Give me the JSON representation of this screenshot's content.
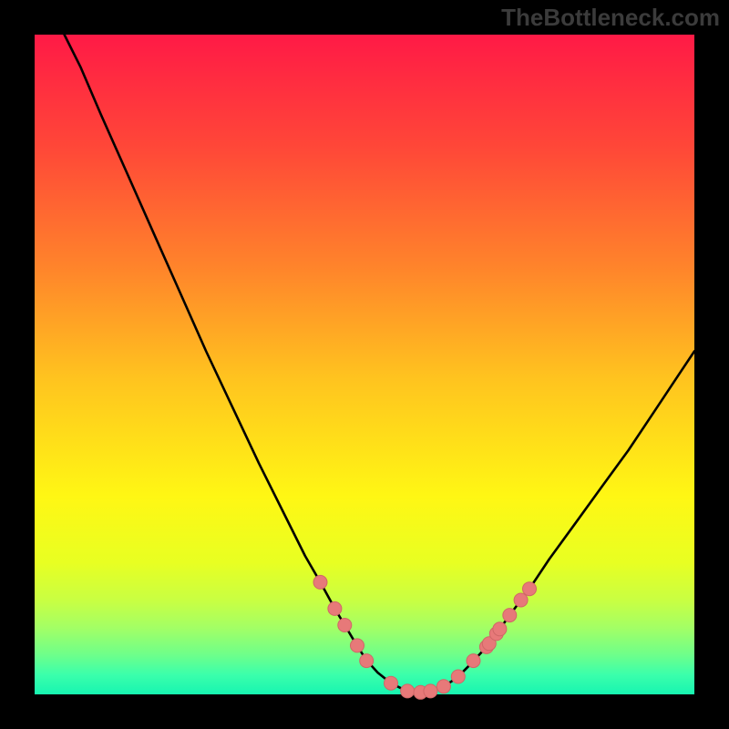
{
  "watermark": "TheBottleneck.com",
  "colors": {
    "background": "#000000",
    "gradient_stops": [
      {
        "offset": 0.0,
        "color": "#ff1a46"
      },
      {
        "offset": 0.17,
        "color": "#ff4738"
      },
      {
        "offset": 0.35,
        "color": "#ff832b"
      },
      {
        "offset": 0.52,
        "color": "#ffc31f"
      },
      {
        "offset": 0.7,
        "color": "#fff714"
      },
      {
        "offset": 0.8,
        "color": "#e8ff22"
      },
      {
        "offset": 0.86,
        "color": "#c7ff44"
      },
      {
        "offset": 0.9,
        "color": "#a2ff66"
      },
      {
        "offset": 0.94,
        "color": "#6eff8a"
      },
      {
        "offset": 0.97,
        "color": "#3bffab"
      },
      {
        "offset": 1.0,
        "color": "#17f5b1"
      }
    ],
    "curve": "#000000",
    "marker_fill": "#e77979",
    "marker_stroke": "#d06767"
  },
  "chart_data": {
    "type": "line",
    "title": "",
    "xlabel": "",
    "ylabel": "",
    "xlim": [
      0,
      100
    ],
    "ylim": [
      0,
      100
    ],
    "note": "y = bottleneck percentage; curve dips to ~0 near x≈58 (optimal match) and rises on both sides",
    "curve": [
      {
        "x": 4.5,
        "y": 100.0
      },
      {
        "x": 7.0,
        "y": 95.0
      },
      {
        "x": 10.0,
        "y": 88.0
      },
      {
        "x": 14.0,
        "y": 79.0
      },
      {
        "x": 18.0,
        "y": 70.0
      },
      {
        "x": 22.0,
        "y": 61.0
      },
      {
        "x": 26.0,
        "y": 52.0
      },
      {
        "x": 30.0,
        "y": 43.5
      },
      {
        "x": 34.0,
        "y": 35.0
      },
      {
        "x": 38.0,
        "y": 27.0
      },
      {
        "x": 41.0,
        "y": 21.0
      },
      {
        "x": 43.3,
        "y": 17.0
      },
      {
        "x": 45.5,
        "y": 13.0
      },
      {
        "x": 47.0,
        "y": 10.5
      },
      {
        "x": 48.5,
        "y": 8.0
      },
      {
        "x": 50.2,
        "y": 5.3
      },
      {
        "x": 52.0,
        "y": 3.3
      },
      {
        "x": 54.0,
        "y": 1.7
      },
      {
        "x": 56.0,
        "y": 0.7
      },
      {
        "x": 58.0,
        "y": 0.3
      },
      {
        "x": 60.0,
        "y": 0.5
      },
      {
        "x": 62.0,
        "y": 1.2
      },
      {
        "x": 64.0,
        "y": 2.5
      },
      {
        "x": 66.0,
        "y": 4.5
      },
      {
        "x": 68.5,
        "y": 7.2
      },
      {
        "x": 70.0,
        "y": 9.2
      },
      {
        "x": 72.0,
        "y": 12.0
      },
      {
        "x": 73.5,
        "y": 14.0
      },
      {
        "x": 75.0,
        "y": 16.0
      },
      {
        "x": 78.0,
        "y": 20.5
      },
      {
        "x": 82.0,
        "y": 26.0
      },
      {
        "x": 86.0,
        "y": 31.5
      },
      {
        "x": 90.0,
        "y": 37.0
      },
      {
        "x": 94.0,
        "y": 43.0
      },
      {
        "x": 98.0,
        "y": 49.0
      },
      {
        "x": 100.0,
        "y": 52.0
      }
    ],
    "markers": [
      {
        "x": 43.3,
        "y": 17.0
      },
      {
        "x": 45.5,
        "y": 13.0
      },
      {
        "x": 47.0,
        "y": 10.5
      },
      {
        "x": 48.9,
        "y": 7.4
      },
      {
        "x": 50.3,
        "y": 5.1
      },
      {
        "x": 54.0,
        "y": 1.7
      },
      {
        "x": 56.5,
        "y": 0.5
      },
      {
        "x": 58.5,
        "y": 0.3
      },
      {
        "x": 60.0,
        "y": 0.5
      },
      {
        "x": 62.0,
        "y": 1.2
      },
      {
        "x": 64.2,
        "y": 2.7
      },
      {
        "x": 66.5,
        "y": 5.1
      },
      {
        "x": 68.5,
        "y": 7.2
      },
      {
        "x": 68.9,
        "y": 7.7
      },
      {
        "x": 70.0,
        "y": 9.2
      },
      {
        "x": 70.5,
        "y": 9.9
      },
      {
        "x": 72.0,
        "y": 12.0
      },
      {
        "x": 73.7,
        "y": 14.3
      },
      {
        "x": 75.0,
        "y": 16.0
      }
    ]
  }
}
